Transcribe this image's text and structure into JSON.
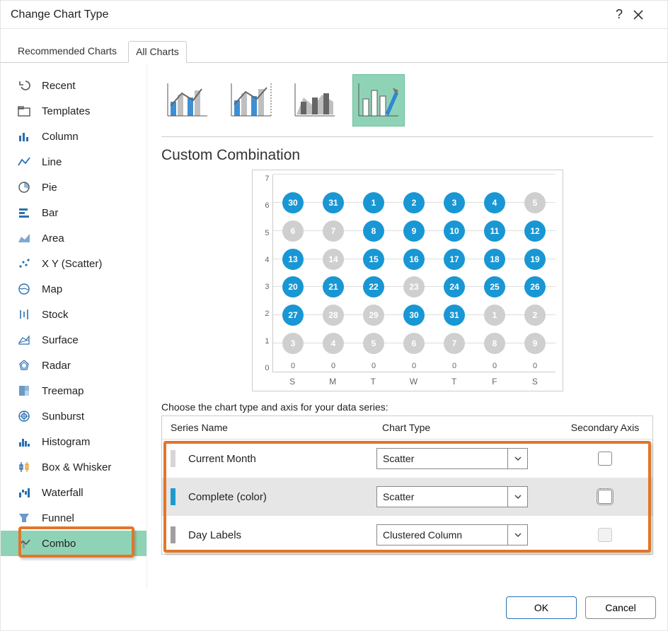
{
  "dialog": {
    "title": "Change Chart Type",
    "help_label": "?",
    "ok_label": "OK",
    "cancel_label": "Cancel"
  },
  "tabs": [
    {
      "label": "Recommended Charts",
      "active": false
    },
    {
      "label": "All Charts",
      "active": true
    }
  ],
  "sidebar": {
    "items": [
      {
        "label": "Recent",
        "icon": "undo-icon"
      },
      {
        "label": "Templates",
        "icon": "folder-icon"
      },
      {
        "label": "Column",
        "icon": "column-icon"
      },
      {
        "label": "Line",
        "icon": "line-icon"
      },
      {
        "label": "Pie",
        "icon": "pie-icon"
      },
      {
        "label": "Bar",
        "icon": "bar-icon"
      },
      {
        "label": "Area",
        "icon": "area-icon"
      },
      {
        "label": "X Y (Scatter)",
        "icon": "scatter-icon"
      },
      {
        "label": "Map",
        "icon": "map-icon"
      },
      {
        "label": "Stock",
        "icon": "stock-icon"
      },
      {
        "label": "Surface",
        "icon": "surface-icon"
      },
      {
        "label": "Radar",
        "icon": "radar-icon"
      },
      {
        "label": "Treemap",
        "icon": "treemap-icon"
      },
      {
        "label": "Sunburst",
        "icon": "sunburst-icon"
      },
      {
        "label": "Histogram",
        "icon": "histogram-icon"
      },
      {
        "label": "Box & Whisker",
        "icon": "box-icon"
      },
      {
        "label": "Waterfall",
        "icon": "waterfall-icon"
      },
      {
        "label": "Funnel",
        "icon": "funnel-icon"
      },
      {
        "label": "Combo",
        "icon": "combo-icon",
        "selected": true
      }
    ]
  },
  "subtypes": {
    "items": [
      {
        "name": "clustered-column-line",
        "selected": false
      },
      {
        "name": "clustered-column-line-secondary",
        "selected": false
      },
      {
        "name": "stacked-area-column",
        "selected": false
      },
      {
        "name": "custom-combination",
        "selected": true
      }
    ]
  },
  "section_title": "Custom Combination",
  "choose_label": "Choose the chart type and axis for your data series:",
  "series_table": {
    "headers": {
      "name": "Series Name",
      "type": "Chart Type",
      "axis": "Secondary Axis"
    },
    "rows": [
      {
        "swatch": "#d6d6d6",
        "name": "Current Month",
        "type": "Scatter",
        "axis_checked": false,
        "axis_disabled": false,
        "selected": false
      },
      {
        "swatch": "#1d9bd1",
        "name": "Complete (color)",
        "type": "Scatter",
        "axis_checked": false,
        "axis_disabled": false,
        "axis_focus": true,
        "selected": true
      },
      {
        "swatch": "#a0a0a0",
        "name": "Day Labels",
        "type": "Clustered Column",
        "axis_checked": false,
        "axis_disabled": true,
        "selected": false
      }
    ]
  },
  "chart_data": {
    "type": "scatter",
    "title": "",
    "y_ticks": [
      0,
      1,
      2,
      3,
      4,
      5,
      6,
      7
    ],
    "ylim": [
      0,
      7
    ],
    "x_categories": [
      "S",
      "M",
      "T",
      "W",
      "T",
      "F",
      "S"
    ],
    "bar_zero_labels": [
      0,
      0,
      0,
      0,
      0,
      0,
      0
    ],
    "points": [
      {
        "x": 1,
        "y": 6,
        "label": "30",
        "series": "blue"
      },
      {
        "x": 2,
        "y": 6,
        "label": "31",
        "series": "blue"
      },
      {
        "x": 3,
        "y": 6,
        "label": "1",
        "series": "blue"
      },
      {
        "x": 4,
        "y": 6,
        "label": "2",
        "series": "blue"
      },
      {
        "x": 5,
        "y": 6,
        "label": "3",
        "series": "blue"
      },
      {
        "x": 6,
        "y": 6,
        "label": "4",
        "series": "blue"
      },
      {
        "x": 7,
        "y": 6,
        "label": "5",
        "series": "gray"
      },
      {
        "x": 1,
        "y": 5,
        "label": "6",
        "series": "gray"
      },
      {
        "x": 2,
        "y": 5,
        "label": "7",
        "series": "gray"
      },
      {
        "x": 3,
        "y": 5,
        "label": "8",
        "series": "blue"
      },
      {
        "x": 4,
        "y": 5,
        "label": "9",
        "series": "blue"
      },
      {
        "x": 5,
        "y": 5,
        "label": "10",
        "series": "blue"
      },
      {
        "x": 6,
        "y": 5,
        "label": "11",
        "series": "blue"
      },
      {
        "x": 7,
        "y": 5,
        "label": "12",
        "series": "blue"
      },
      {
        "x": 1,
        "y": 4,
        "label": "13",
        "series": "blue"
      },
      {
        "x": 2,
        "y": 4,
        "label": "14",
        "series": "gray"
      },
      {
        "x": 3,
        "y": 4,
        "label": "15",
        "series": "blue"
      },
      {
        "x": 4,
        "y": 4,
        "label": "16",
        "series": "blue"
      },
      {
        "x": 5,
        "y": 4,
        "label": "17",
        "series": "blue"
      },
      {
        "x": 6,
        "y": 4,
        "label": "18",
        "series": "blue"
      },
      {
        "x": 7,
        "y": 4,
        "label": "19",
        "series": "blue"
      },
      {
        "x": 1,
        "y": 3,
        "label": "20",
        "series": "blue"
      },
      {
        "x": 2,
        "y": 3,
        "label": "21",
        "series": "blue"
      },
      {
        "x": 3,
        "y": 3,
        "label": "22",
        "series": "blue"
      },
      {
        "x": 4,
        "y": 3,
        "label": "23",
        "series": "gray"
      },
      {
        "x": 5,
        "y": 3,
        "label": "24",
        "series": "blue"
      },
      {
        "x": 6,
        "y": 3,
        "label": "25",
        "series": "blue"
      },
      {
        "x": 7,
        "y": 3,
        "label": "26",
        "series": "blue"
      },
      {
        "x": 1,
        "y": 2,
        "label": "27",
        "series": "blue"
      },
      {
        "x": 2,
        "y": 2,
        "label": "28",
        "series": "gray"
      },
      {
        "x": 3,
        "y": 2,
        "label": "29",
        "series": "gray"
      },
      {
        "x": 4,
        "y": 2,
        "label": "30",
        "series": "blue"
      },
      {
        "x": 5,
        "y": 2,
        "label": "31",
        "series": "blue"
      },
      {
        "x": 6,
        "y": 2,
        "label": "1",
        "series": "gray"
      },
      {
        "x": 7,
        "y": 2,
        "label": "2",
        "series": "gray"
      },
      {
        "x": 1,
        "y": 1,
        "label": "3",
        "series": "gray"
      },
      {
        "x": 2,
        "y": 1,
        "label": "4",
        "series": "gray"
      },
      {
        "x": 3,
        "y": 1,
        "label": "5",
        "series": "gray"
      },
      {
        "x": 4,
        "y": 1,
        "label": "6",
        "series": "gray"
      },
      {
        "x": 5,
        "y": 1,
        "label": "7",
        "series": "gray"
      },
      {
        "x": 6,
        "y": 1,
        "label": "8",
        "series": "gray"
      },
      {
        "x": 7,
        "y": 1,
        "label": "9",
        "series": "gray"
      }
    ],
    "series_legend": [
      {
        "name": "Complete (color)",
        "color": "#1897d4"
      },
      {
        "name": "Current Month",
        "color": "#cfcfcf"
      }
    ]
  }
}
